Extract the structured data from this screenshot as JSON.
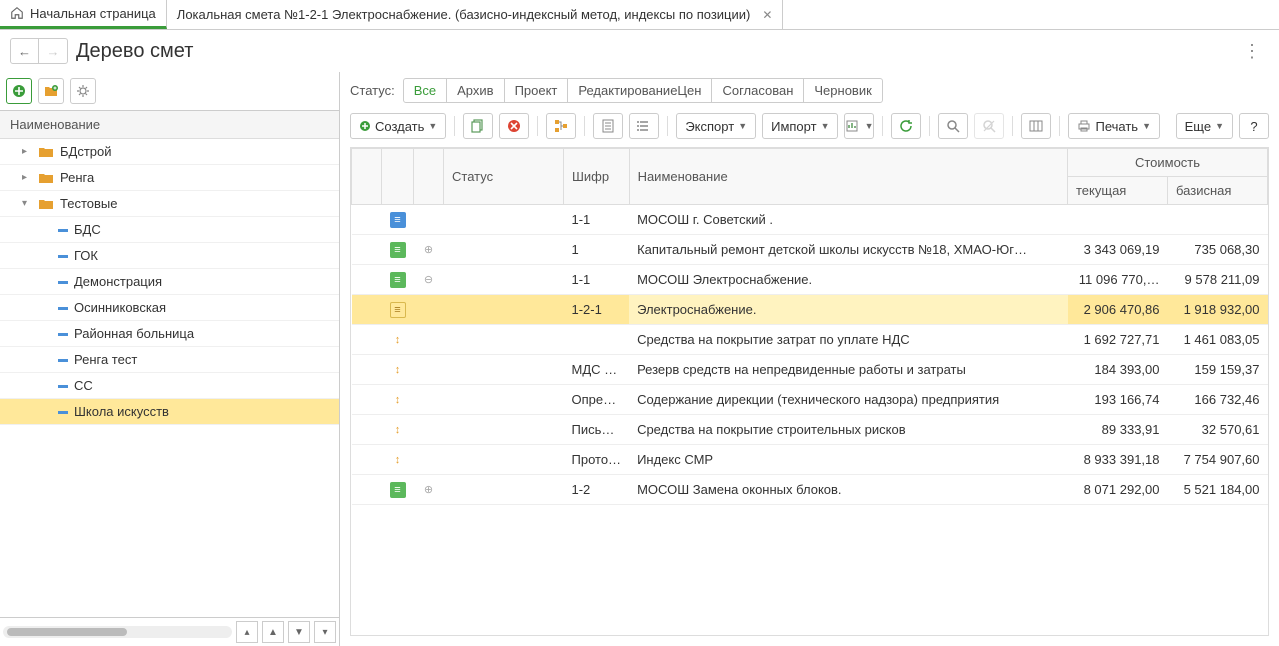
{
  "tabs": {
    "home": "Начальная страница",
    "doc": "Локальная смета №1-2-1 Электроснабжение. (базисно-индексный метод, индексы по позиции)"
  },
  "pageTitle": "Дерево смет",
  "tree": {
    "header": "Наименование",
    "items": [
      {
        "l": 1,
        "type": "folder",
        "exp": "▸",
        "label": "БДстрой"
      },
      {
        "l": 1,
        "type": "folder",
        "exp": "▸",
        "label": "Ренга"
      },
      {
        "l": 1,
        "type": "folder",
        "exp": "▾",
        "label": "Тестовые"
      },
      {
        "l": 2,
        "type": "doc",
        "label": "БДС"
      },
      {
        "l": 2,
        "type": "doc",
        "label": "ГОК"
      },
      {
        "l": 2,
        "type": "doc",
        "label": "Демонстрация"
      },
      {
        "l": 2,
        "type": "doc",
        "label": "Осинниковская"
      },
      {
        "l": 2,
        "type": "doc",
        "label": "Районная больница"
      },
      {
        "l": 2,
        "type": "doc",
        "label": "Ренга тест"
      },
      {
        "l": 2,
        "type": "doc",
        "label": "СС"
      },
      {
        "l": 2,
        "type": "doc",
        "label": "Школа искусств",
        "sel": true
      }
    ]
  },
  "status": {
    "label": "Статус:",
    "tabs": [
      "Все",
      "Архив",
      "Проект",
      "РедактированиеЦен",
      "Согласован",
      "Черновик"
    ]
  },
  "toolbar": {
    "create": "Создать",
    "export": "Экспорт",
    "import": "Импорт",
    "print": "Печать",
    "more": "Еще"
  },
  "grid": {
    "headers": {
      "status": "Статус",
      "code": "Шифр",
      "name": "Наименование",
      "cost": "Стоимость",
      "current": "текущая",
      "base": "базисная"
    },
    "rows": [
      {
        "icon": "blue",
        "code": "1-1",
        "name": "МОСОШ г. Советский .",
        "cur": "",
        "base": ""
      },
      {
        "icon": "green",
        "exp": "⊕",
        "code": "1",
        "name": "Капитальный ремонт детской школы искусств №18,  ХМАО-Юг…",
        "cur": "3 343 069,19",
        "base": "735 068,30"
      },
      {
        "icon": "green",
        "exp": "⊖",
        "code": "1-1",
        "name": "МОСОШ Электроснабжение.",
        "cur": "11 096 770,…",
        "base": "9 578 211,09"
      },
      {
        "icon": "yellow",
        "code": "1-2-1",
        "name": "Электроснабжение.",
        "cur": "2 906 470,86",
        "base": "1 918 932,00",
        "hl": true
      },
      {
        "icon": "arrow",
        "code": "",
        "name": "Средства на покрытие затрат по уплате НДС",
        "cur": "1 692 727,71",
        "base": "1 461 083,05"
      },
      {
        "icon": "arrow",
        "code": "МДС …",
        "name": "Резерв средств на непредвиденные работы и затраты",
        "cur": "184 393,00",
        "base": "159 159,37"
      },
      {
        "icon": "arrow",
        "code": "Опре…",
        "name": "Содержание дирекции (технического надзора) предприятия",
        "cur": "193 166,74",
        "base": "166 732,46"
      },
      {
        "icon": "arrow",
        "code": "Пись…",
        "name": "Средства на покрытие строительных рисков",
        "cur": "89 333,91",
        "base": "32 570,61"
      },
      {
        "icon": "arrow",
        "code": "Прото…",
        "name": "Индекс СМР",
        "cur": "8 933 391,18",
        "base": "7 754 907,60"
      },
      {
        "icon": "green",
        "exp": "⊕",
        "code": "1-2",
        "name": "МОСОШ Замена оконных блоков.",
        "cur": "8 071 292,00",
        "base": "5 521 184,00"
      }
    ]
  }
}
